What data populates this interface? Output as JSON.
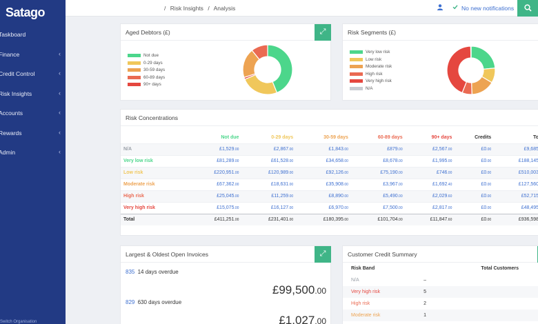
{
  "brand": {
    "logo": "Satago"
  },
  "sidebar": {
    "items": [
      {
        "label": "Taskboard",
        "has_children": false
      },
      {
        "label": "Finance",
        "has_children": true
      },
      {
        "label": "Credit Control",
        "has_children": true
      },
      {
        "label": "Risk Insights",
        "has_children": true
      },
      {
        "label": "Accounts",
        "has_children": true
      },
      {
        "label": "Rewards",
        "has_children": true
      },
      {
        "label": "Admin",
        "has_children": true
      }
    ],
    "footer": "Switch Organisation"
  },
  "topbar": {
    "breadcrumb": [
      "/",
      "Risk Insights",
      "/",
      "Analysis"
    ],
    "notifications": "No new notifications",
    "icons": {
      "user": "user-icon",
      "check": "check-icon",
      "search": "search-icon"
    }
  },
  "colors": {
    "accent": "#3fb587",
    "link": "#3d6fd0",
    "sidebar": "#223a84",
    "not_due": "#4cd68b",
    "d0_29": "#f0c75b",
    "d30_59": "#eda352",
    "d60_89": "#ea6a52",
    "d90_plus": "#e5473f",
    "na": "#c8cbd1"
  },
  "aged_debtors": {
    "title": "Aged Debtors (£)",
    "legend": [
      {
        "label": "Not due",
        "color": "#4cd68b"
      },
      {
        "label": "0-29 days",
        "color": "#f0c75b"
      },
      {
        "label": "30-59 days",
        "color": "#eda352"
      },
      {
        "label": "60-89 days",
        "color": "#ea6a52"
      },
      {
        "label": "90+ days",
        "color": "#e5473f"
      }
    ],
    "slices": [
      {
        "label": "Not due",
        "value": 411251,
        "color": "#4cd68b"
      },
      {
        "label": "0-29 days",
        "value": 231401,
        "color": "#f0c75b"
      },
      {
        "label": "90+ days",
        "value": 11847,
        "color": "#e5473f"
      },
      {
        "label": "30-59 days",
        "value": 180395,
        "color": "#eda352"
      },
      {
        "label": "60-89 days",
        "value": 101704,
        "color": "#ea6a52"
      }
    ]
  },
  "risk_segments": {
    "title": "Risk Segments (£)",
    "legend": [
      {
        "label": "Very low risk",
        "color": "#4cd68b"
      },
      {
        "label": "Low risk",
        "color": "#f0c75b"
      },
      {
        "label": "Moderate risk",
        "color": "#eda352"
      },
      {
        "label": "High risk",
        "color": "#ea6a52"
      },
      {
        "label": "Very high risk",
        "color": "#e5473f"
      },
      {
        "label": "N/A",
        "color": "#c8cbd1"
      }
    ],
    "slices": [
      {
        "label": "Very low risk",
        "value": 188145,
        "color": "#4cd68b"
      },
      {
        "label": "Low risk",
        "value": 80000,
        "color": "#f0c75b"
      },
      {
        "label": "Moderate risk",
        "value": 127560,
        "color": "#eda352"
      },
      {
        "label": "High risk",
        "value": 52715,
        "color": "#ea6a52"
      },
      {
        "label": "Very high risk",
        "value": 350000,
        "color": "#e5473f"
      },
      {
        "label": "N/A",
        "value": 2000,
        "color": "#c8cbd1"
      }
    ]
  },
  "risk_concentrations": {
    "title": "Risk Concentrations",
    "columns": [
      {
        "label": "Not due",
        "color": "#4cd68b"
      },
      {
        "label": "0-29 days",
        "color": "#f0c75b"
      },
      {
        "label": "30-59 days",
        "color": "#eda352"
      },
      {
        "label": "60-89 days",
        "color": "#ea6a52"
      },
      {
        "label": "90+ days",
        "color": "#e5473f"
      },
      {
        "label": "Credits",
        "color": "#333333"
      },
      {
        "label": "To",
        "color": "#333333"
      }
    ],
    "rows": [
      {
        "label": "N/A",
        "color": "#9aa0a8",
        "cells": [
          [
            "£1,529",
            ".00"
          ],
          [
            "£2,867",
            ".00"
          ],
          [
            "£1,843",
            ".00"
          ],
          [
            "£879",
            ".00"
          ],
          [
            "£2,567",
            ".00"
          ],
          [
            "£0",
            ".00"
          ],
          [
            "£9,685",
            ""
          ]
        ]
      },
      {
        "label": "Very low risk",
        "color": "#4cd68b",
        "cells": [
          [
            "£81,289",
            ".00"
          ],
          [
            "£61,528",
            ".00"
          ],
          [
            "£34,658",
            ".00"
          ],
          [
            "£8,678",
            ".00"
          ],
          [
            "£1,995",
            ".00"
          ],
          [
            "£0",
            ".00"
          ],
          [
            "£188,145",
            ""
          ]
        ]
      },
      {
        "label": "Low risk",
        "color": "#f0c75b",
        "cells": [
          [
            "£220,951",
            ".00"
          ],
          [
            "£120,989",
            ".00"
          ],
          [
            "£92,126",
            ".00"
          ],
          [
            "£75,190",
            ".00"
          ],
          [
            "£746",
            ".00"
          ],
          [
            "£0",
            ".00"
          ],
          [
            "£510,003",
            ""
          ]
        ]
      },
      {
        "label": "Moderate risk",
        "color": "#eda352",
        "cells": [
          [
            "£67,362",
            ".00"
          ],
          [
            "£18,631",
            ".00"
          ],
          [
            "£35,908",
            ".00"
          ],
          [
            "£3,967",
            ".00"
          ],
          [
            "£1,692",
            ".40"
          ],
          [
            "£0",
            ".00"
          ],
          [
            "£127,560",
            ""
          ]
        ]
      },
      {
        "label": "High risk",
        "color": "#ea6a52",
        "cells": [
          [
            "£25,045",
            ".00"
          ],
          [
            "£11,259",
            ".00"
          ],
          [
            "£8,890",
            ".00"
          ],
          [
            "£5,490",
            ".00"
          ],
          [
            "£2,029",
            ".60"
          ],
          [
            "£0",
            ".00"
          ],
          [
            "£52,715",
            ""
          ]
        ]
      },
      {
        "label": "Very high risk",
        "color": "#e5473f",
        "cells": [
          [
            "£15,075",
            ".00"
          ],
          [
            "£16,127",
            ".00"
          ],
          [
            "£6,970",
            ".00"
          ],
          [
            "£7,500",
            ".00"
          ],
          [
            "£2,817",
            ".00"
          ],
          [
            "£0",
            ".00"
          ],
          [
            "£48,495",
            ""
          ]
        ]
      }
    ],
    "total": {
      "label": "Total",
      "cells": [
        [
          "£411,251",
          ".00"
        ],
        [
          "£231,401",
          ".00"
        ],
        [
          "£180,395",
          ".00"
        ],
        [
          "£101,704",
          ".00"
        ],
        [
          "£11,847",
          ".60"
        ],
        [
          "£0",
          ".00"
        ],
        [
          "£936,598",
          ""
        ]
      ]
    }
  },
  "largest_invoices": {
    "title": "Largest & Oldest Open Invoices",
    "items": [
      {
        "ref": "835",
        "text": "14 days overdue",
        "amount": "£99,500",
        "cents": ".00"
      },
      {
        "ref": "829",
        "text": "630 days overdue",
        "amount": "£1,027",
        "cents": ".00"
      }
    ]
  },
  "credit_summary": {
    "title": "Customer Credit Summary",
    "headers": [
      "Risk Band",
      "",
      "Total Customers"
    ],
    "rows": [
      {
        "band": "N/A",
        "color": "#9aa0a8",
        "count": "–"
      },
      {
        "band": "Very high risk",
        "color": "#e5473f",
        "count": "5"
      },
      {
        "band": "High risk",
        "color": "#ea6a52",
        "count": "2"
      },
      {
        "band": "Moderate risk",
        "color": "#eda352",
        "count": "1"
      }
    ]
  }
}
